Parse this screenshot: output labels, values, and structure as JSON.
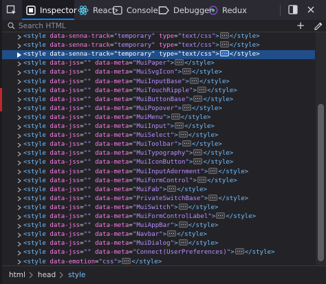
{
  "toolbar": {
    "tabs": [
      {
        "label": "Inspector",
        "icon": "inspector-icon"
      },
      {
        "label": "React",
        "icon": "react-icon"
      },
      {
        "label": "Console",
        "icon": "console-icon"
      },
      {
        "label": "Debugger",
        "icon": "debugger-icon"
      },
      {
        "label": "Redux",
        "icon": "redux-icon"
      }
    ],
    "active_tab": "Inspector"
  },
  "search": {
    "placeholder": "Search HTML"
  },
  "markup": {
    "rows": [
      {
        "tag": "style",
        "attrs": [
          {
            "name": "data-senna-track",
            "value": "\"temporary\""
          },
          {
            "name": "type",
            "value": "\"text/css\""
          }
        ],
        "collapsed": true
      },
      {
        "tag": "style",
        "attrs": [
          {
            "name": "data-senna-track",
            "value": "\"temporary\""
          },
          {
            "name": "type",
            "value": "\"text/css\""
          }
        ],
        "collapsed": true
      },
      {
        "tag": "style",
        "attrs": [
          {
            "name": "data-senna-track",
            "value": "\"temporary\""
          },
          {
            "name": "type",
            "value": "\"text/css\""
          }
        ],
        "collapsed": true,
        "selected": true
      },
      {
        "tag": "style",
        "attrs": [
          {
            "name": "data-jss",
            "value": "\"\""
          },
          {
            "name": "data-meta",
            "value": "\"MuiPaper\""
          }
        ],
        "collapsed": true
      },
      {
        "tag": "style",
        "attrs": [
          {
            "name": "data-jss",
            "value": "\"\""
          },
          {
            "name": "data-meta",
            "value": "\"MuiSvgIcon\""
          }
        ],
        "collapsed": true
      },
      {
        "tag": "style",
        "attrs": [
          {
            "name": "data-jss",
            "value": "\"\""
          },
          {
            "name": "data-meta",
            "value": "\"MuiInputBase\""
          }
        ],
        "collapsed": true
      },
      {
        "tag": "style",
        "attrs": [
          {
            "name": "data-jss",
            "value": "\"\""
          },
          {
            "name": "data-meta",
            "value": "\"MuiTouchRipple\""
          }
        ],
        "collapsed": true
      },
      {
        "tag": "style",
        "attrs": [
          {
            "name": "data-jss",
            "value": "\"\""
          },
          {
            "name": "data-meta",
            "value": "\"MuiButtonBase\""
          }
        ],
        "collapsed": true
      },
      {
        "tag": "style",
        "attrs": [
          {
            "name": "data-jss",
            "value": "\"\""
          },
          {
            "name": "data-meta",
            "value": "\"MuiPopover\""
          }
        ],
        "collapsed": true
      },
      {
        "tag": "style",
        "attrs": [
          {
            "name": "data-jss",
            "value": "\"\""
          },
          {
            "name": "data-meta",
            "value": "\"MuiMenu\""
          }
        ],
        "collapsed": true
      },
      {
        "tag": "style",
        "attrs": [
          {
            "name": "data-jss",
            "value": "\"\""
          },
          {
            "name": "data-meta",
            "value": "\"MuiInput\""
          }
        ],
        "collapsed": true
      },
      {
        "tag": "style",
        "attrs": [
          {
            "name": "data-jss",
            "value": "\"\""
          },
          {
            "name": "data-meta",
            "value": "\"MuiSelect\""
          }
        ],
        "collapsed": true
      },
      {
        "tag": "style",
        "attrs": [
          {
            "name": "data-jss",
            "value": "\"\""
          },
          {
            "name": "data-meta",
            "value": "\"MuiToolbar\""
          }
        ],
        "collapsed": true
      },
      {
        "tag": "style",
        "attrs": [
          {
            "name": "data-jss",
            "value": "\"\""
          },
          {
            "name": "data-meta",
            "value": "\"MuiTypography\""
          }
        ],
        "collapsed": true
      },
      {
        "tag": "style",
        "attrs": [
          {
            "name": "data-jss",
            "value": "\"\""
          },
          {
            "name": "data-meta",
            "value": "\"MuiIconButton\""
          }
        ],
        "collapsed": true
      },
      {
        "tag": "style",
        "attrs": [
          {
            "name": "data-jss",
            "value": "\"\""
          },
          {
            "name": "data-meta",
            "value": "\"MuiInputAdornment\""
          }
        ],
        "collapsed": true
      },
      {
        "tag": "style",
        "attrs": [
          {
            "name": "data-jss",
            "value": "\"\""
          },
          {
            "name": "data-meta",
            "value": "\"MuiFormControl\""
          }
        ],
        "collapsed": true
      },
      {
        "tag": "style",
        "attrs": [
          {
            "name": "data-jss",
            "value": "\"\""
          },
          {
            "name": "data-meta",
            "value": "\"MuiFab\""
          }
        ],
        "collapsed": true
      },
      {
        "tag": "style",
        "attrs": [
          {
            "name": "data-jss",
            "value": "\"\""
          },
          {
            "name": "data-meta",
            "value": "\"PrivateSwitchBase\""
          }
        ],
        "collapsed": true
      },
      {
        "tag": "style",
        "attrs": [
          {
            "name": "data-jss",
            "value": "\"\""
          },
          {
            "name": "data-meta",
            "value": "\"MuiSwitch\""
          }
        ],
        "collapsed": true
      },
      {
        "tag": "style",
        "attrs": [
          {
            "name": "data-jss",
            "value": "\"\""
          },
          {
            "name": "data-meta",
            "value": "\"MuiFormControlLabel\""
          }
        ],
        "collapsed": true
      },
      {
        "tag": "style",
        "attrs": [
          {
            "name": "data-jss",
            "value": "\"\""
          },
          {
            "name": "data-meta",
            "value": "\"MuiAppBar\""
          }
        ],
        "collapsed": true
      },
      {
        "tag": "style",
        "attrs": [
          {
            "name": "data-jss",
            "value": "\"\""
          },
          {
            "name": "data-meta",
            "value": "\"Navbar\""
          }
        ],
        "collapsed": true
      },
      {
        "tag": "style",
        "attrs": [
          {
            "name": "data-jss",
            "value": "\"\""
          },
          {
            "name": "data-meta",
            "value": "\"MuiDialog\""
          }
        ],
        "collapsed": true
      },
      {
        "tag": "style",
        "attrs": [
          {
            "name": "data-jss",
            "value": "\"\""
          },
          {
            "name": "data-meta",
            "value": "\"Connect(UserPreferences)\""
          }
        ],
        "collapsed": true
      },
      {
        "tag": "style",
        "attrs": [
          {
            "name": "data-emotion",
            "value": "\"css\""
          }
        ],
        "collapsed": true
      }
    ]
  },
  "breadcrumbs": [
    "html",
    "head",
    "style"
  ],
  "colors": {
    "background": "#232327",
    "toolbar": "#2b2a33",
    "selection": "#204e8a",
    "tag": "#75bfff",
    "attr_name": "#fb7be6",
    "attr_value": "#b98eff",
    "accent": "#0a84ff"
  }
}
